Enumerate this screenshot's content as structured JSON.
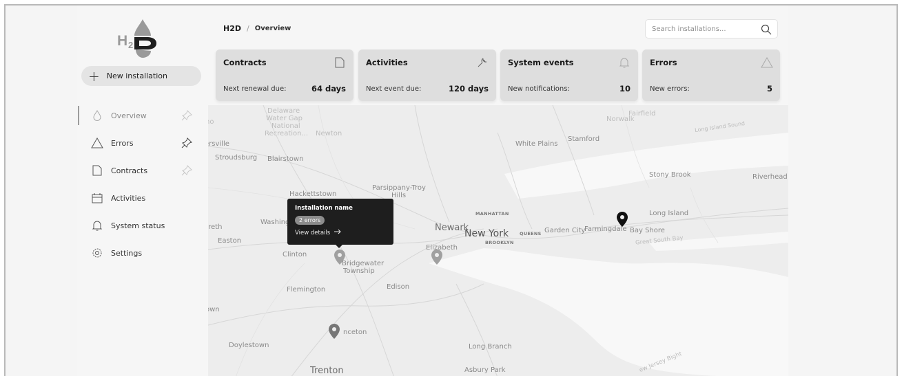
{
  "app": {
    "logo_text": "H2D"
  },
  "sidebar": {
    "new_button_label": "New installation",
    "items": [
      {
        "label": "Overview",
        "icon": "drop-icon",
        "pinned": true,
        "active": true
      },
      {
        "label": "Errors",
        "icon": "warning-icon",
        "pinned": true,
        "active": false
      },
      {
        "label": "Contracts",
        "icon": "document-icon",
        "pinned": true,
        "active": false
      },
      {
        "label": "Activities",
        "icon": "calendar-icon",
        "pinned": false,
        "active": false
      },
      {
        "label": "System status",
        "icon": "bell-icon",
        "pinned": false,
        "active": false
      },
      {
        "label": "Settings",
        "icon": "gear-icon",
        "pinned": false,
        "active": false
      }
    ]
  },
  "header": {
    "breadcrumb_root": "H2D",
    "breadcrumb_sep": "/",
    "breadcrumb_current": "Overview",
    "search_placeholder": "Search installations..."
  },
  "cards": [
    {
      "title": "Contracts",
      "icon": "document-icon",
      "meta": "Next renewal due:",
      "value": "64 days"
    },
    {
      "title": "Activities",
      "icon": "wrench-icon",
      "meta": "Next event due:",
      "value": "120 days"
    },
    {
      "title": "System events",
      "icon": "bell-icon",
      "meta": "New notifications:",
      "value": "10"
    },
    {
      "title": "Errors",
      "icon": "warning-icon",
      "meta": "New errors:",
      "value": "5"
    }
  ],
  "map": {
    "places": [
      "Delaware",
      "Water Gap",
      "National",
      "Recreation...",
      "Newton",
      "ersville",
      "Stroudsburg",
      "Blairstown",
      "Hackettstown",
      "Parsippany-Troy",
      "Hills",
      "wn",
      "Washing",
      "areth",
      "Easton",
      "Clinton",
      "Bridgewater",
      "Township",
      "Flemington",
      "Edison",
      "own",
      "Doylestown",
      "nceton",
      "Trenton",
      "Long Branch",
      "Asbury Park",
      "Newark",
      "New York",
      "MANHATTAN",
      "BROOKLYN",
      "QUEENS",
      "Elizabeth",
      "White Plains",
      "Stamford",
      "Norwalk",
      "Fairfield",
      "Long Island Sound",
      "Stony Brook",
      "Riverhead",
      "Long Island",
      "Garden City",
      "Farmingdale",
      "Bay Shore",
      "Great South Bay",
      "ew Jersey Bight",
      "no"
    ],
    "tooltip": {
      "title": "Installation name",
      "badge": "2 errors",
      "link": "View details",
      "link_icon": "arrow-right-icon"
    }
  }
}
